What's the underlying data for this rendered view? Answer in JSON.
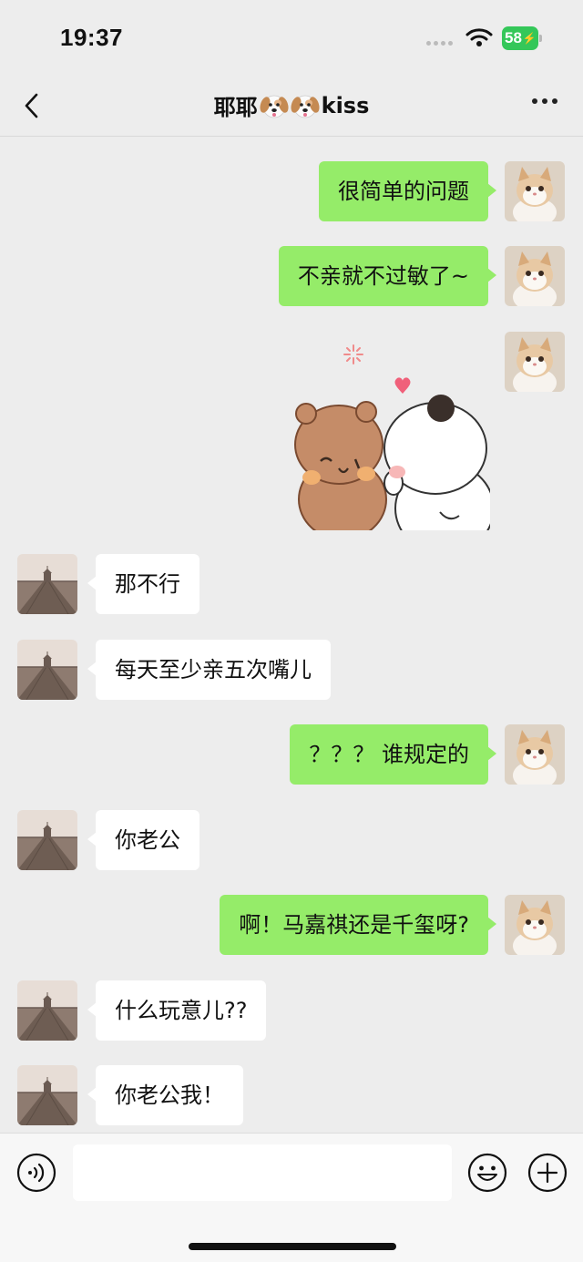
{
  "status_bar": {
    "time": "19:37",
    "battery": "58"
  },
  "chat": {
    "title_prefix": "耶耶",
    "title_suffix": "kiss"
  },
  "messages": [
    {
      "sender": "me",
      "text": "很简单的问题"
    },
    {
      "sender": "me",
      "text": "不亲就不过敏了~"
    },
    {
      "sender": "me",
      "type": "sticker",
      "icon": "bear-kiss-sticker"
    },
    {
      "sender": "them",
      "text": "那不行"
    },
    {
      "sender": "them",
      "text": "每天至少亲五次嘴儿"
    },
    {
      "sender": "me",
      "text": "？？？ 谁规定的"
    },
    {
      "sender": "them",
      "text": "你老公"
    },
    {
      "sender": "me",
      "text": "啊！马嘉祺还是千玺呀?"
    },
    {
      "sender": "them",
      "text": "什么玩意儿??"
    },
    {
      "sender": "them",
      "text": "你老公我！"
    }
  ],
  "input": {
    "placeholder": ""
  },
  "colors": {
    "my_bubble": "#95ec69",
    "their_bubble": "#ffffff",
    "background": "#ededed"
  }
}
